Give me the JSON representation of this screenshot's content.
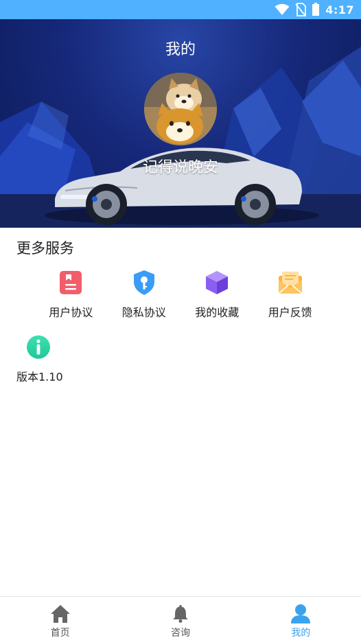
{
  "status_bar": {
    "time": "4:17",
    "icons": [
      "wifi-icon",
      "no-sim-icon",
      "battery-icon"
    ],
    "background": "#4fb1ff"
  },
  "header": {
    "title": "我的",
    "nickname": "记得说晚安",
    "avatar": "shiba-dog-avatar"
  },
  "services": {
    "title": "更多服务",
    "items": [
      {
        "label": "用户协议",
        "icon": "user-agreement-icon",
        "color": "#f25d6a"
      },
      {
        "label": "隐私协议",
        "icon": "privacy-key-icon",
        "color": "#3a9cf5"
      },
      {
        "label": "我的收藏",
        "icon": "cube-icon",
        "color": "#8a5ef0"
      },
      {
        "label": "用户反馈",
        "icon": "mail-feedback-icon",
        "color": "#ffb23c"
      }
    ],
    "version": {
      "label": "版本1.10",
      "icon": "info-icon",
      "color": "#27d3a0"
    }
  },
  "bottom_nav": {
    "items": [
      {
        "label": "首页",
        "icon": "home-icon",
        "active": false
      },
      {
        "label": "咨询",
        "icon": "bell-icon",
        "active": false
      },
      {
        "label": "我的",
        "icon": "user-icon",
        "active": true
      }
    ],
    "active_color": "#3aa3f0",
    "inactive_color": "#555555"
  }
}
